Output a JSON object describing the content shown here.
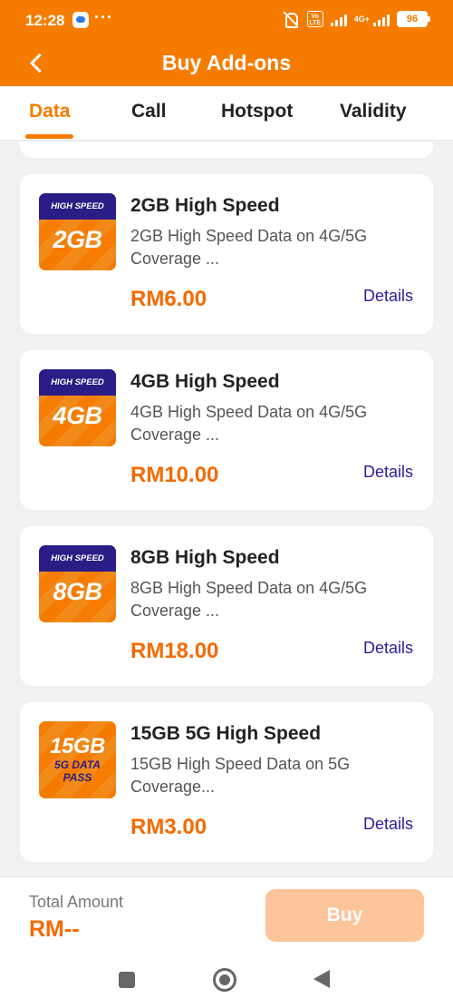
{
  "status_bar": {
    "time": "12:28",
    "more": "···",
    "volte": "Vo LTE",
    "network": "4G+",
    "battery": "96"
  },
  "header": {
    "title": "Buy Add-ons"
  },
  "tabs": [
    {
      "label": "Data",
      "active": true
    },
    {
      "label": "Call",
      "active": false
    },
    {
      "label": "Hotspot",
      "active": false
    },
    {
      "label": "Validity",
      "active": false
    }
  ],
  "products": [
    {
      "image": {
        "band": "HIGH SPEED",
        "size": "2GB"
      },
      "name": "2GB High Speed",
      "description": "2GB High Speed Data on 4G/5G Coverage ...",
      "price": "RM6.00",
      "details_label": "Details"
    },
    {
      "image": {
        "band": "HIGH SPEED",
        "size": "4GB"
      },
      "name": "4GB High Speed",
      "description": "4GB High Speed Data on 4G/5G Coverage ...",
      "price": "RM10.00",
      "details_label": "Details"
    },
    {
      "image": {
        "band": "HIGH SPEED",
        "size": "8GB"
      },
      "name": "8GB High Speed",
      "description": "8GB High Speed Data on 4G/5G Coverage ...",
      "price": "RM18.00",
      "details_label": "Details"
    },
    {
      "image": {
        "size": "15GB",
        "sub_line1": "5G DATA",
        "sub_line2": "PASS"
      },
      "name": "15GB 5G High Speed",
      "description": "15GB High Speed Data on 5G Coverage...",
      "price": "RM3.00",
      "details_label": "Details"
    }
  ],
  "footer": {
    "total_label": "Total Amount",
    "total_value": "RM--",
    "buy_label": "Buy"
  },
  "colors": {
    "brand": "#f57c00",
    "price": "#f56a00",
    "link": "#2b1da0",
    "band": "#2b1d86",
    "buy_disabled": "#fcc49a"
  }
}
